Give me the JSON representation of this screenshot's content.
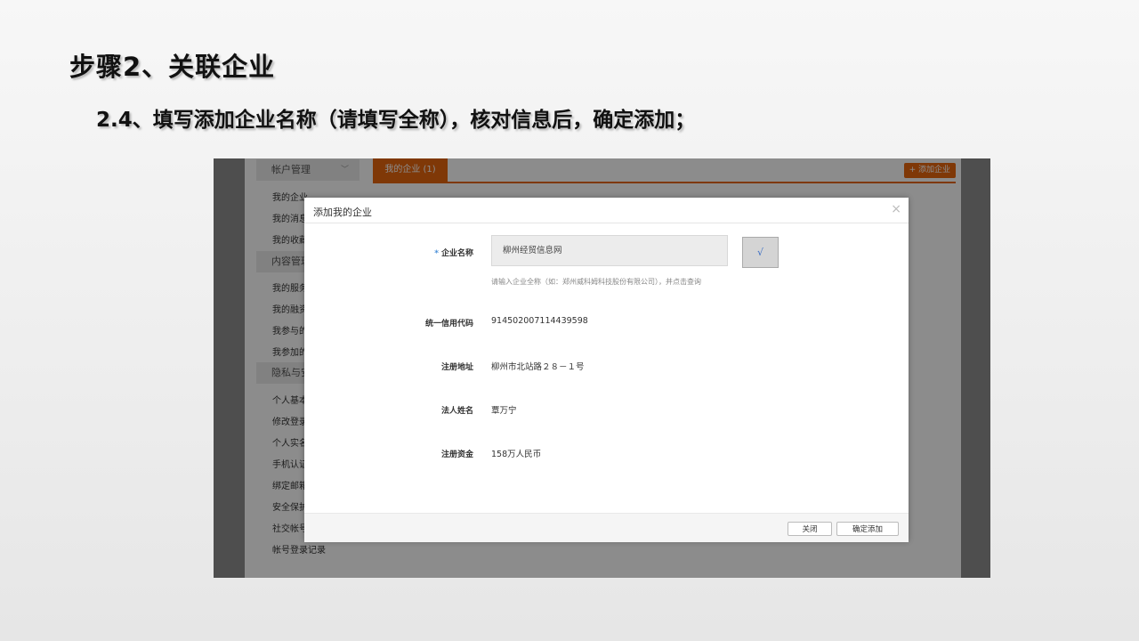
{
  "slide": {
    "title": "步骤2、关联企业",
    "subtitle": "2.4、填写添加企业名称（请填写全称），核对信息后，确定添加；"
  },
  "sidebar": {
    "groups": [
      {
        "label": "帐户管理",
        "items": [
          "我的企业",
          "我的消息",
          "我的收藏"
        ]
      },
      {
        "label": "内容管理",
        "items": [
          "我的服务",
          "我的融资",
          "我参与的",
          "我参加的"
        ]
      },
      {
        "label": "隐私与安全",
        "items": [
          "个人基本",
          "修改登录",
          "个人实名",
          "手机认证",
          "绑定邮箱",
          "安全保护",
          "社交帐号",
          "帐号登录记录"
        ]
      }
    ],
    "group1_chevron": "﹀"
  },
  "tabs": {
    "active": "我的企业 (1)",
    "add_button": "+ 添加企业"
  },
  "modal": {
    "title": "添加我的企业",
    "close_icon": "×",
    "required_mark": "*",
    "company_name_label": "企业名称",
    "company_name_value": "柳州经贸信息网",
    "query_button": "√",
    "hint": "请输入企业全称（如：郑州威科姆科技股份有限公司），并点击查询",
    "credit_code_label": "统一信用代码",
    "credit_code_value": "914502007114439598",
    "address_label": "注册地址",
    "address_value": "柳州市北站路２８－１号",
    "legal_person_label": "法人姓名",
    "legal_person_value": "覃万宁",
    "capital_label": "注册资金",
    "capital_value": "158万人民币",
    "close_button": "关闭",
    "confirm_button": "确定添加"
  },
  "colors": {
    "accent": "#e8660d",
    "link": "#4a90d9"
  }
}
